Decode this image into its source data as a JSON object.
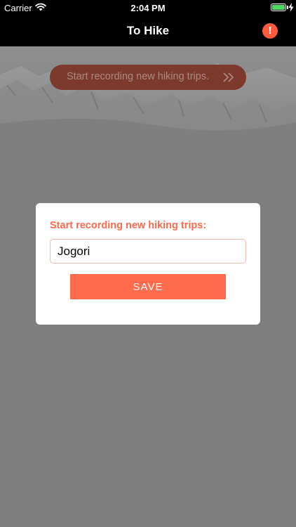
{
  "status_bar": {
    "carrier": "Carrier",
    "time": "2:04 PM",
    "battery_level": 1.0
  },
  "nav_bar": {
    "title": "To Hike",
    "alert_icon_glyph": "!",
    "alert_icon": "exclamation-circle-icon"
  },
  "banner": {
    "text": "Start recording new hiking trips.",
    "icon": "double-chevron-right-icon"
  },
  "dialog": {
    "title": "Start recording new hiking trips:",
    "input_value": "Jogori",
    "save_label": "SAVE"
  },
  "colors": {
    "accent": "#ff6a4d",
    "nav_background": "#000000",
    "overlay": "#7e7e7e",
    "battery_green": "#4cd964"
  }
}
